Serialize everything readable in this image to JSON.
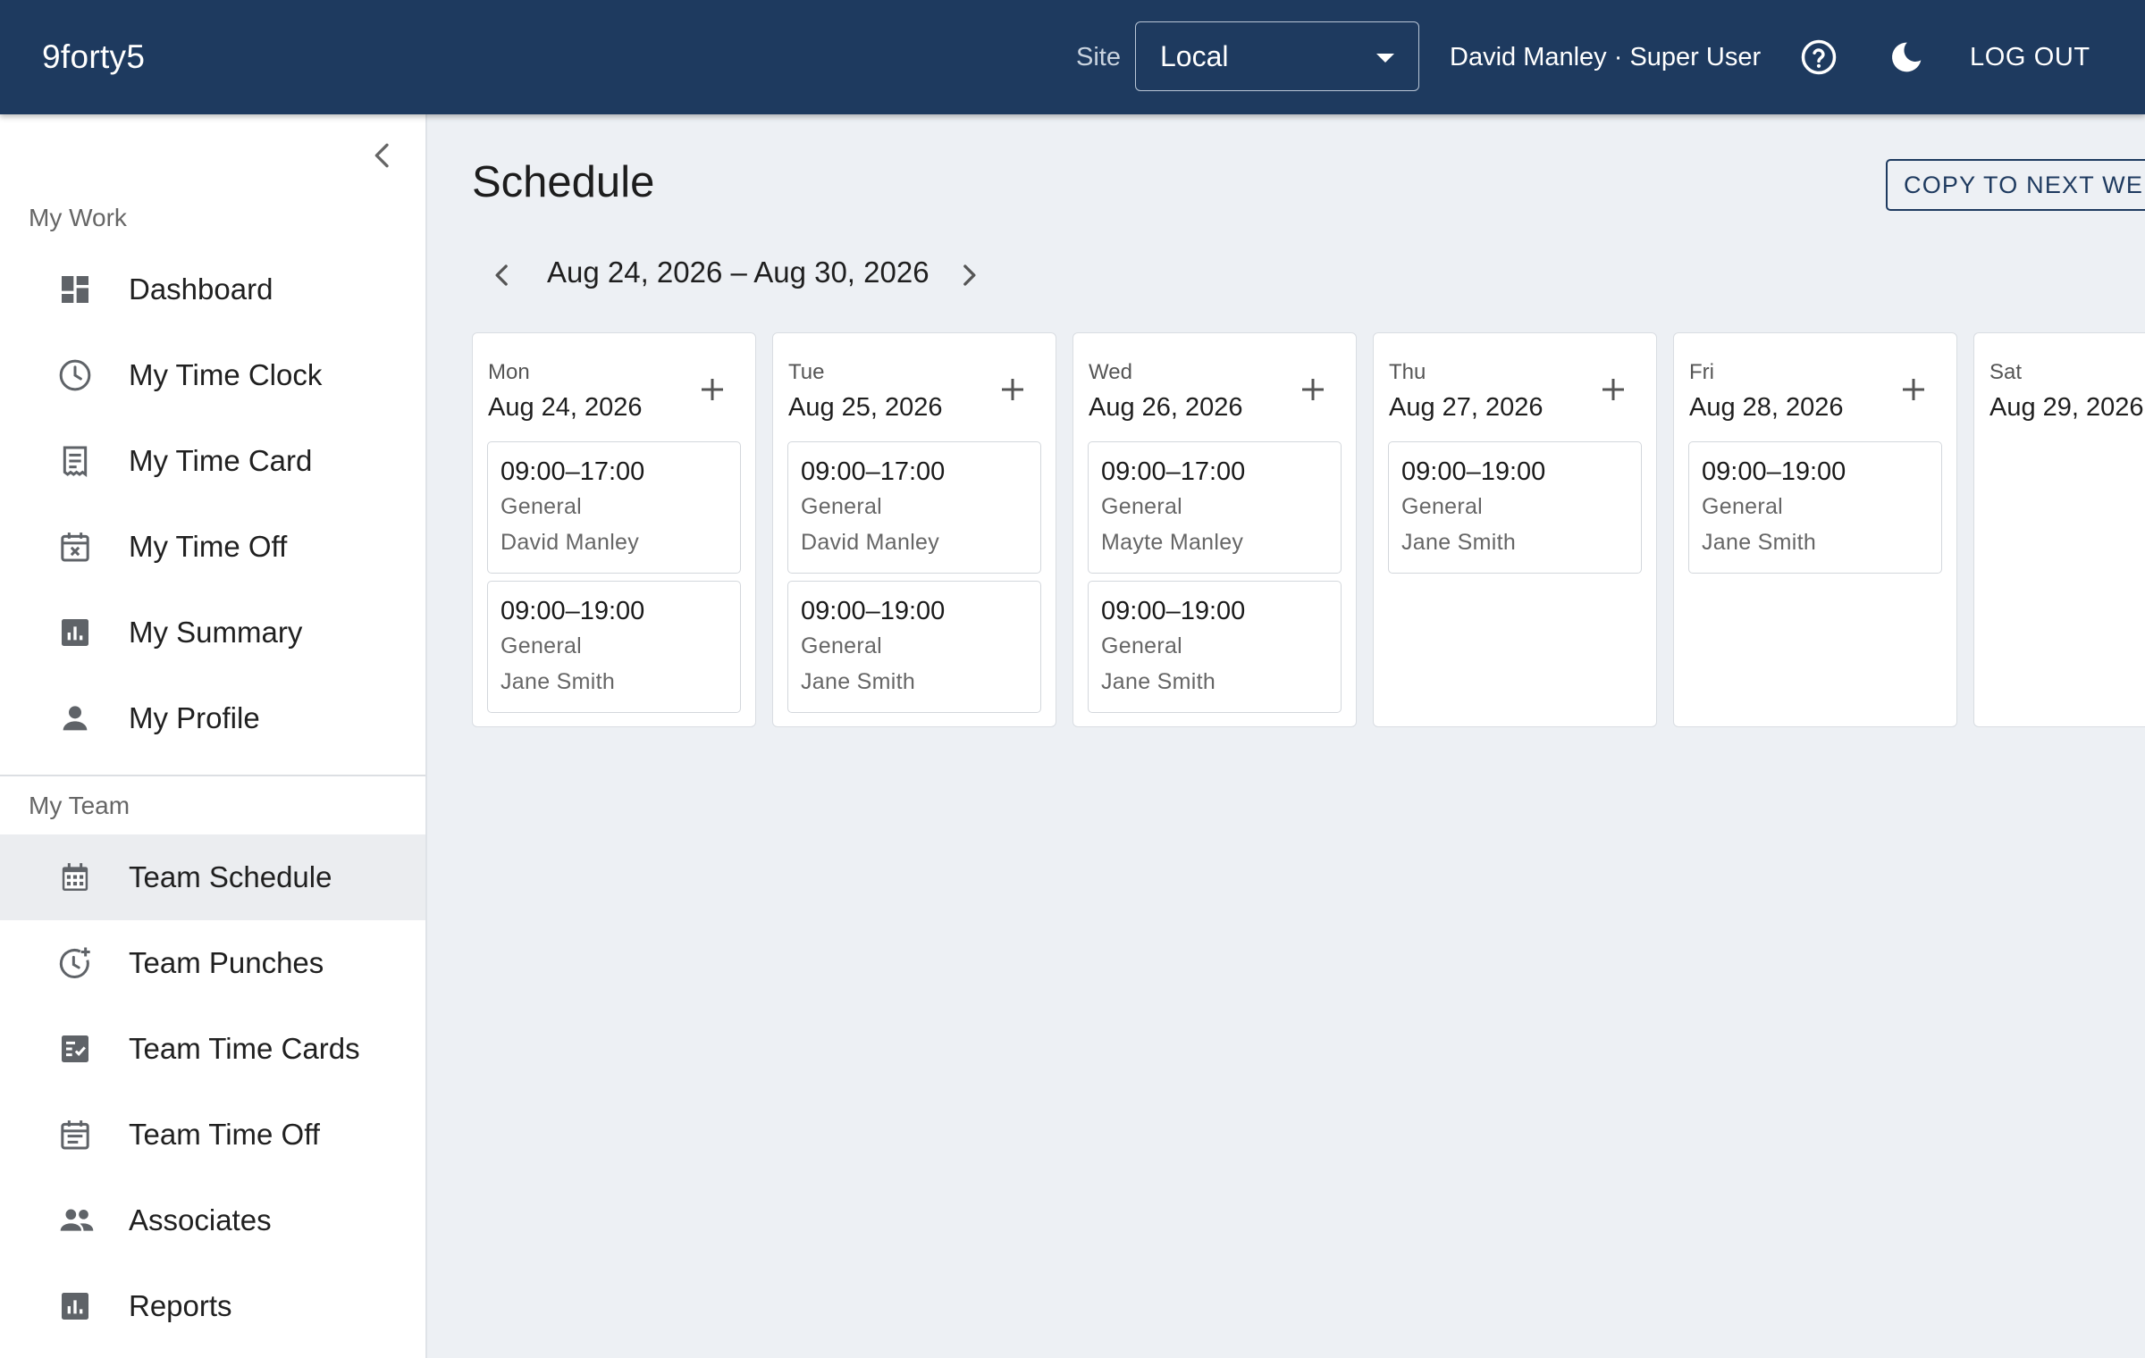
{
  "header": {
    "brand": "9forty5",
    "site_label": "Site",
    "site_value": "Local",
    "user": "David Manley · Super User",
    "help_icon": "help-circle-icon",
    "theme_icon": "moon-icon",
    "logout": "LOG OUT"
  },
  "sidebar": {
    "my_work_title": "My Work",
    "my_work": [
      {
        "label": "Dashboard",
        "icon": "dashboard-icon"
      },
      {
        "label": "My Time Clock",
        "icon": "clock-icon"
      },
      {
        "label": "My Time Card",
        "icon": "receipt-icon"
      },
      {
        "label": "My Time Off",
        "icon": "calendar-x-icon"
      },
      {
        "label": "My Summary",
        "icon": "bar-chart-icon"
      },
      {
        "label": "My Profile",
        "icon": "person-icon"
      }
    ],
    "my_team_title": "My Team",
    "my_team": [
      {
        "label": "Team Schedule",
        "icon": "calendar-grid-icon",
        "active": true
      },
      {
        "label": "Team Punches",
        "icon": "clock-plus-icon"
      },
      {
        "label": "Team Time Cards",
        "icon": "checklist-icon"
      },
      {
        "label": "Team Time Off",
        "icon": "calendar-note-icon"
      },
      {
        "label": "Associates",
        "icon": "people-icon"
      },
      {
        "label": "Reports",
        "icon": "bar-chart-icon"
      }
    ]
  },
  "main": {
    "title": "Schedule",
    "copy_button": "COPY TO NEXT WEEK",
    "week_range": "Aug 24, 2026 – Aug 30, 2026",
    "days": [
      {
        "name": "Mon",
        "date": "Aug 24, 2026",
        "shifts": [
          {
            "time": "09:00–17:00",
            "role": "General",
            "person": "David Manley"
          },
          {
            "time": "09:00–19:00",
            "role": "General",
            "person": "Jane Smith"
          }
        ]
      },
      {
        "name": "Tue",
        "date": "Aug 25, 2026",
        "shifts": [
          {
            "time": "09:00–17:00",
            "role": "General",
            "person": "David Manley"
          },
          {
            "time": "09:00–19:00",
            "role": "General",
            "person": "Jane Smith"
          }
        ]
      },
      {
        "name": "Wed",
        "date": "Aug 26, 2026",
        "shifts": [
          {
            "time": "09:00–17:00",
            "role": "General",
            "person": "Mayte Manley"
          },
          {
            "time": "09:00–19:00",
            "role": "General",
            "person": "Jane Smith"
          }
        ]
      },
      {
        "name": "Thu",
        "date": "Aug 27, 2026",
        "shifts": [
          {
            "time": "09:00–19:00",
            "role": "General",
            "person": "Jane Smith"
          }
        ]
      },
      {
        "name": "Fri",
        "date": "Aug 28, 2026",
        "shifts": [
          {
            "time": "09:00–19:00",
            "role": "General",
            "person": "Jane Smith"
          }
        ]
      },
      {
        "name": "Sat",
        "date": "Aug 29, 2026",
        "shifts": []
      }
    ]
  },
  "colors": {
    "header_bg": "#1e3a5f",
    "page_bg": "#edf0f4",
    "active_nav_bg": "#ebedf0"
  }
}
